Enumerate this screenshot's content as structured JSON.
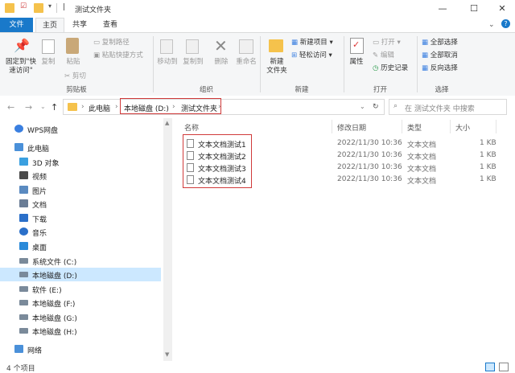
{
  "window": {
    "title": "测试文件夹",
    "controls": {
      "minimize": "—",
      "maximize": "☐",
      "close": "✕"
    }
  },
  "ribbon": {
    "tabs": [
      {
        "label": "文件"
      },
      {
        "label": "主页"
      },
      {
        "label": "共享"
      },
      {
        "label": "查看"
      }
    ],
    "clipboard": {
      "pin": "固定到\"快速访问\"",
      "copy": "复制",
      "paste": "粘贴",
      "copy_path": "复制路径",
      "paste_shortcut": "粘贴快捷方式",
      "cut": "剪切",
      "group": "剪贴板"
    },
    "organize": {
      "move_to": "移动到",
      "copy_to": "复制到",
      "delete": "删除",
      "rename": "重命名",
      "group": "组织"
    },
    "new": {
      "new_folder": "新建\n文件夹",
      "new_item": "新建项目",
      "easy_access": "轻松访问",
      "group": "新建"
    },
    "open": {
      "properties": "属性",
      "open": "打开",
      "edit": "编辑",
      "history": "历史记录",
      "group": "打开"
    },
    "select": {
      "select_all": "全部选择",
      "select_none": "全部取消",
      "invert": "反向选择",
      "group": "选择"
    }
  },
  "address": {
    "crumbs": [
      "此电脑",
      "本地磁盘 (D:)",
      "测试文件夹"
    ],
    "search_placeholder": "在 测试文件夹 中搜索"
  },
  "nav": {
    "items": [
      {
        "label": "WPS网盘",
        "color": "#3a7fe0"
      },
      {
        "label": "此电脑",
        "color": "#4a90d9"
      },
      {
        "label": "3D 对象",
        "color": "#3aa0e0"
      },
      {
        "label": "视频",
        "color": "#4a4a4a"
      },
      {
        "label": "图片",
        "color": "#5a8ac0"
      },
      {
        "label": "文档",
        "color": "#6a7d96"
      },
      {
        "label": "下载",
        "color": "#2a6fc9"
      },
      {
        "label": "音乐",
        "color": "#2a6fc9"
      },
      {
        "label": "桌面",
        "color": "#2a8ad9"
      },
      {
        "label": "系统文件 (C:)",
        "color": "#7a8a9a"
      },
      {
        "label": "本地磁盘 (D:)",
        "color": "#7a8a9a"
      },
      {
        "label": "软件 (E:)",
        "color": "#7a8a9a"
      },
      {
        "label": "本地磁盘 (F:)",
        "color": "#7a8a9a"
      },
      {
        "label": "本地磁盘 (G:)",
        "color": "#7a8a9a"
      },
      {
        "label": "本地磁盘 (H:)",
        "color": "#7a8a9a"
      },
      {
        "label": "网络",
        "color": "#4a90d9"
      }
    ]
  },
  "files": {
    "headers": {
      "name": "名称",
      "date": "修改日期",
      "type": "类型",
      "size": "大小"
    },
    "rows": [
      {
        "name": "文本文档测试1",
        "date": "2022/11/30 10:36",
        "type": "文本文档",
        "size": "1 KB"
      },
      {
        "name": "文本文档测试2",
        "date": "2022/11/30 10:36",
        "type": "文本文档",
        "size": "1 KB"
      },
      {
        "name": "文本文档测试3",
        "date": "2022/11/30 10:36",
        "type": "文本文档",
        "size": "1 KB"
      },
      {
        "name": "文本文档测试4",
        "date": "2022/11/30 10:36",
        "type": "文本文档",
        "size": "1 KB"
      }
    ]
  },
  "status": {
    "count": "4 个项目"
  },
  "colors": {
    "accent": "#1979ca",
    "highlight": "#d03a3a",
    "selected": "#cce8ff",
    "folder": "#f5c24c"
  }
}
